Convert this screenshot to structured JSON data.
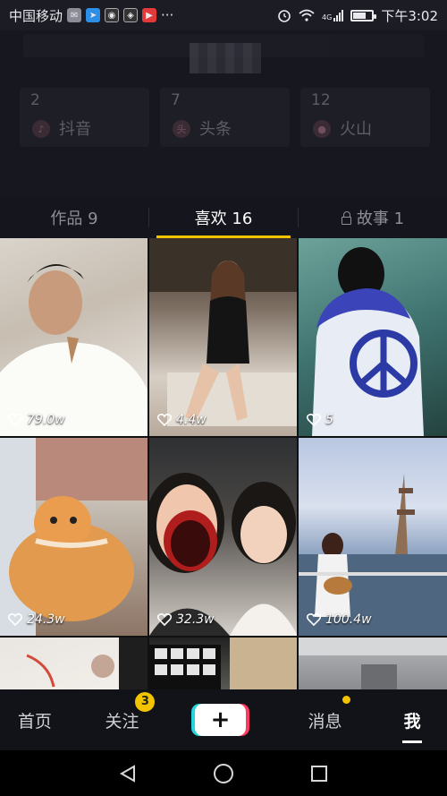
{
  "status_bar": {
    "carrier": "中国移动",
    "time": "下午3:02",
    "signal": "4G",
    "battery_level": 0.7
  },
  "profile": {
    "apps": [
      {
        "count": "2",
        "label": "抖音"
      },
      {
        "count": "7",
        "label": "头条"
      },
      {
        "count": "12",
        "label": "火山"
      }
    ]
  },
  "tabs": [
    {
      "label": "作品 9"
    },
    {
      "label": "喜欢 16"
    },
    {
      "label": "故事 1"
    }
  ],
  "grid": [
    {
      "likes": "79.0w"
    },
    {
      "likes": "4.4w"
    },
    {
      "likes": "5"
    },
    {
      "likes": "24.3w"
    },
    {
      "likes": "32.3w"
    },
    {
      "likes": "100.4w"
    }
  ],
  "bottom_nav": {
    "home": "首页",
    "follow": "关注",
    "follow_badge": "3",
    "create": "+",
    "messages": "消息",
    "me": "我"
  },
  "colors": {
    "accent": "#f2c400",
    "background": "#14151c",
    "tiktok_cyan": "#26d4df",
    "tiktok_red": "#ff3a60"
  }
}
